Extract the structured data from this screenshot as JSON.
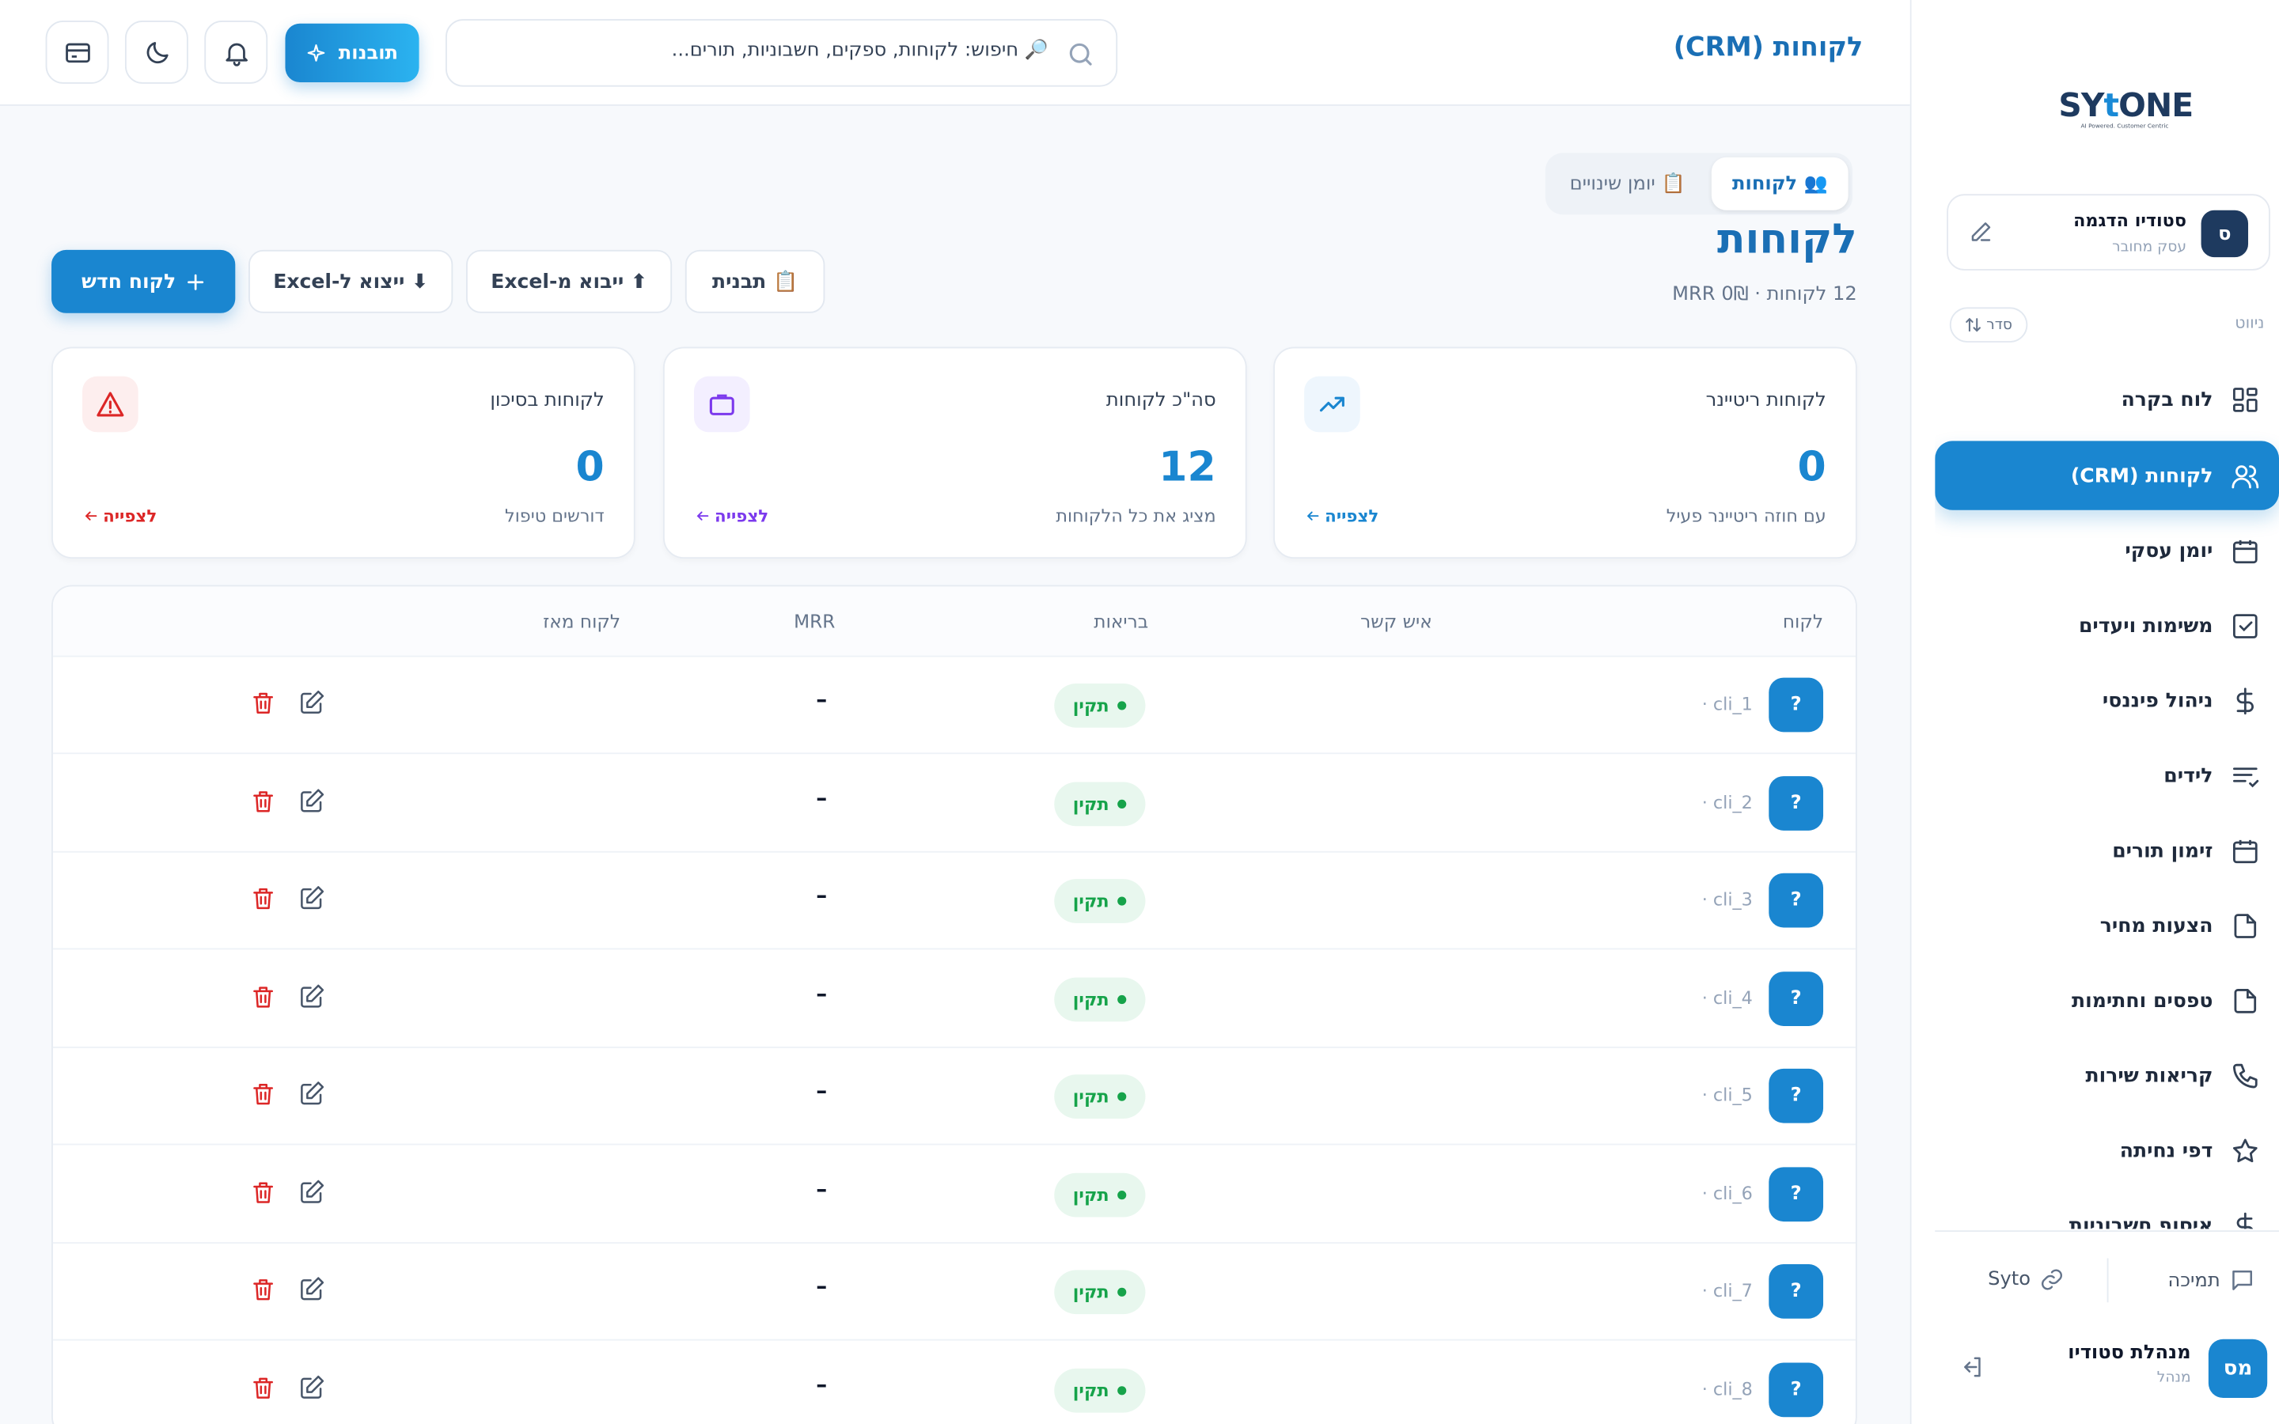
{
  "brand": {
    "logo_pre": "SY",
    "logo_t": "t",
    "logo_post": "ONE",
    "tagline": "AI Powered. Customer Centric"
  },
  "colors": {
    "accent": "#1a86d0",
    "title": "#1a6fb5",
    "danger": "#dc2626",
    "purple": "#7c3aed",
    "success": "#16a34a"
  },
  "studio": {
    "avatar": "ס",
    "name": "סטודיו הדגמה",
    "sub": "עסק מחובר"
  },
  "nav": {
    "heading": "ניווט",
    "sort_label": "סדר",
    "items": [
      {
        "label": "לוח בקרה",
        "icon": "dashboard-icon"
      },
      {
        "label": "לקוחות (CRM)",
        "icon": "users-icon",
        "active": true
      },
      {
        "label": "יומן עסקי",
        "icon": "calendar-icon"
      },
      {
        "label": "משימות ויעדים",
        "icon": "checkbox-icon"
      },
      {
        "label": "ניהול פיננסי",
        "icon": "dollar-icon"
      },
      {
        "label": "לידים",
        "icon": "list-icon"
      },
      {
        "label": "זימון תורים",
        "icon": "calendar-icon"
      },
      {
        "label": "הצעות מחיר",
        "icon": "file-icon"
      },
      {
        "label": "טפסים וחתימות",
        "icon": "file-icon"
      },
      {
        "label": "קריאות שירות",
        "icon": "phone-icon"
      },
      {
        "label": "דפי נחיתה",
        "icon": "star-icon"
      },
      {
        "label": "איסוף חשבוניות",
        "icon": "dollar-icon"
      }
    ]
  },
  "footer": {
    "support": "תמיכה",
    "syto": "Syto",
    "user_avatar": "מס",
    "user_name": "מנהלת סטודיו",
    "user_role": "מנהל"
  },
  "header": {
    "title": "לקוחות (CRM)",
    "search_placeholder": "🔎 חיפוש: לקוחות, ספקים, חשבוניות, תורים...",
    "insights_label": "תובנות"
  },
  "tabs": [
    {
      "label": "👥 לקוחות",
      "active": true
    },
    {
      "label": "📋 יומן שינויים",
      "active": false
    }
  ],
  "page": {
    "title": "לקוחות",
    "subtitle": "12 לקוחות · 0₪ MRR"
  },
  "actions": {
    "template": "📋 תבנית",
    "import": "⬆ ייבוא מ-Excel",
    "export": "⬇ ייצוא ל-Excel",
    "new_client": "לקוח חדש"
  },
  "cards": [
    {
      "title": "לקוחות ריטיינר",
      "value": "0",
      "desc": "עם חוזה ריטיינר פעיל",
      "link": "לצפייה",
      "icon": "trend-up-icon"
    },
    {
      "title": "סה\"כ לקוחות",
      "value": "12",
      "desc": "מציג את כל הלקוחות",
      "link": "לצפייה",
      "icon": "briefcase-icon"
    },
    {
      "title": "לקוחות בסיכון",
      "value": "0",
      "desc": "דורשים טיפול",
      "link": "לצפייה",
      "icon": "warning-icon"
    }
  ],
  "table": {
    "columns": {
      "client": "לקוח",
      "contact": "איש קשר",
      "health": "בריאות",
      "mrr": "MRR",
      "since": "לקוח מאז"
    },
    "rows": [
      {
        "avatar": "?",
        "id": "· cli_1",
        "health": "תקין",
        "mrr": "–"
      },
      {
        "avatar": "?",
        "id": "· cli_2",
        "health": "תקין",
        "mrr": "–"
      },
      {
        "avatar": "?",
        "id": "· cli_3",
        "health": "תקין",
        "mrr": "–"
      },
      {
        "avatar": "?",
        "id": "· cli_4",
        "health": "תקין",
        "mrr": "–"
      },
      {
        "avatar": "?",
        "id": "· cli_5",
        "health": "תקין",
        "mrr": "–"
      },
      {
        "avatar": "?",
        "id": "· cli_6",
        "health": "תקין",
        "mrr": "–"
      },
      {
        "avatar": "?",
        "id": "· cli_7",
        "health": "תקין",
        "mrr": "–"
      },
      {
        "avatar": "?",
        "id": "· cli_8",
        "health": "תקין",
        "mrr": "–"
      }
    ]
  }
}
